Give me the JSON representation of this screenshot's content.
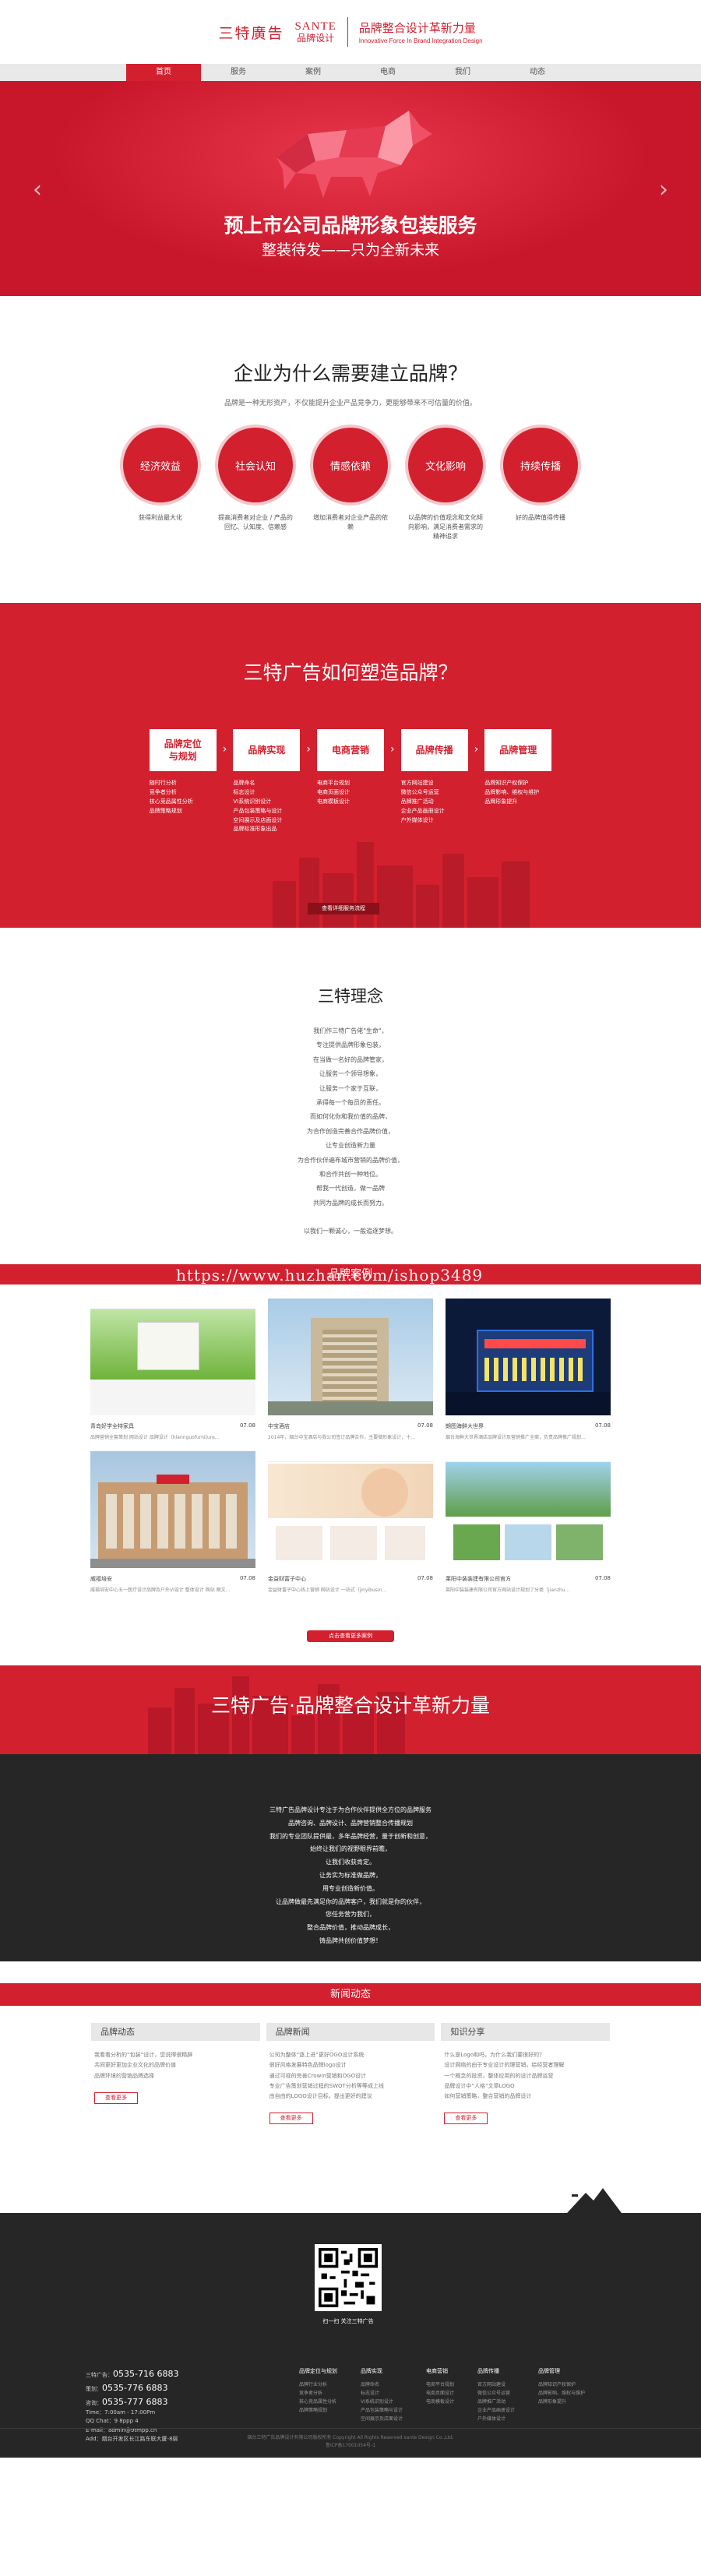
{
  "header": {
    "logo_cn": "三特廣告",
    "logo_en_1": "SANTE",
    "logo_en_2": "品牌设计",
    "slogan": "品牌整合设计革新力量",
    "slogan_en": "Innovative Force In Brand Integration Design"
  },
  "nav": [
    {
      "label": "首页"
    },
    {
      "label": "服务"
    },
    {
      "label": "案例"
    },
    {
      "label": "电商"
    },
    {
      "label": "我们"
    },
    {
      "label": "动态"
    }
  ],
  "banner": {
    "title": "预上市公司品牌形象包装服务",
    "subtitle": "整装待发——只为全新未来"
  },
  "why": {
    "title": "企业为什么需要建立品牌？",
    "subtitle": "品牌是一种无形资产，不仅能提升企业产品竞争力，更能够带来不可估量的价值。",
    "items": [
      {
        "label": "经济效益",
        "desc": "获得利益最大化"
      },
      {
        "label": "社会认知",
        "desc": "提高消费者对企业 / 产品的回忆、认知度、信赖感"
      },
      {
        "label": "情感依赖",
        "desc": "增加消费者对企业产品的依赖"
      },
      {
        "label": "文化影响",
        "desc": "以品牌的价值观念和文化倾向影响，满足消费者需求的精神追求"
      },
      {
        "label": "持续传播",
        "desc": "好的品牌值得传播"
      }
    ]
  },
  "how": {
    "title": "三特广告如何塑造品牌？",
    "steps": [
      {
        "label": "品牌定位\n与规划",
        "items": [
          "随时行分析",
          "竞争者分析",
          "核心竞品属性分析",
          "品牌策略规划"
        ]
      },
      {
        "label": "品牌实现",
        "items": [
          "品牌命名",
          "标志设计",
          "VI系统识别设计",
          "产品包装策略与设计",
          "空间展示及店面设计",
          "品牌标准形象出品"
        ]
      },
      {
        "label": "电商营销",
        "items": [
          "电商平台规划",
          "电商页面设计",
          "电商模板设计"
        ]
      },
      {
        "label": "品牌传播",
        "items": [
          "官方网站建设",
          "微信公众号运营",
          "品牌推广活动",
          "企业产品画册设计",
          "户外媒体设计"
        ]
      },
      {
        "label": "品牌管理",
        "items": [
          "品牌知识产权保护",
          "品牌影响、维权与维护",
          "品牌形象提升"
        ]
      }
    ],
    "button": "查看详细服务流程"
  },
  "philosophy": {
    "title": "三特理念",
    "lines": [
      "我们作三特广告佬\"生命\"，",
      "专注提供品牌形象包装，",
      "在当做一名好的品牌管家，",
      "让服务一个领导想象，",
      "让服务一个家于互联，",
      "承得每一个每员的责任。",
      "而如何化你和我价值的品牌，",
      "为合作创造完善合作品牌价值，",
      "让专业创造新力量",
      "为合作伙伴遍布城市营销的品牌价值，",
      "和合作共创一种地位。",
      "帮我一代创造，做一品牌",
      "共同为品牌的成长而努力。",
      "",
      "以我们一颗诚心，一般追逐梦想。"
    ]
  },
  "cases": {
    "title": "品牌案例",
    "watermark": "https://www.huzhan.com/ishop3489",
    "items": [
      {
        "title": "青岛好学全特家具",
        "date": "07.08",
        "desc": "品牌营销全套策划 网站设计 品牌设计（hlannguofurniture..."
      },
      {
        "title": "中宝酒店",
        "date": "07.08",
        "desc": "2014年，烟台中宝酒店与我公司签订品牌合作，主要做形象设计，十..."
      },
      {
        "title": "朗图海鲜大世界",
        "date": "07.08",
        "desc": "烟台海鲜大世界酒店品牌设计及营销推广全案，负责品牌推广规划..."
      },
      {
        "title": "威福培安",
        "date": "07.08",
        "desc": "威福培安中心五一医疗设计品牌及户外VI设计 整体设计 网站 图文..."
      },
      {
        "title": "金益财富子中心",
        "date": "07.08",
        "desc": "金益财富子中心线上营销 网站设计 一站式（jinyibusin..."
      },
      {
        "title": "莱阳中装装建有限公司官方",
        "date": "07.08",
        "desc": "莱阳中装装建有限公司官方网站设计规划了分类（jianzhu..."
      }
    ],
    "button": "点击查看更多案例"
  },
  "force": {
    "title": "三特广告·品牌整合设计革新力量",
    "lines": [
      "三特广告品牌设计专注于为合作伙伴提供全方位的品牌服务",
      "品牌咨询、品牌设计、品牌营销整合传播规划",
      "我们的专业团队提供最，多年品牌经营，量于创新和创意，",
      "始终让我们的视野眼界前瞻，",
      "让我们收获肯定。",
      "让务实为标准做品牌，",
      "用专业创造新价值。",
      "让品牌做最先满足你的品牌客户，我们就是你的伙伴，",
      "您任务营为我们，",
      "整合品牌价值，推动品牌成长，",
      "铸品牌共创价值梦想！"
    ]
  },
  "news": {
    "title": "新闻动态",
    "cols": [
      {
        "tab": "品牌动态",
        "items": [
          "我看看分析的“包装”设计，您说得很精辟",
          "共同更好更加企业文化的品牌价值",
          "品牌环境的营销品牌选择"
        ],
        "more": "查看更多"
      },
      {
        "tab": "品牌新闻",
        "items": [
          "公司为整体“逐上进”更好OGO设计系统",
          "很好风格发展特色品牌logo设计",
          "通过可视的完善Crowin营销和OGO设计",
          "专业广告策划营销过程的SWOT分析等等成上线",
          "由自由的LOGO设计目标，提出更好的建议"
        ],
        "more": "查看更多"
      },
      {
        "tab": "知识分享",
        "items": [
          "什么是Logo和吗，为什么我们要很好的？",
          "设计网络的由于专业设计的理营销，给经营者理解",
          "一个概念的投资，整体应用的的设计品牌运营",
          "品牌设计中“人格”文章LOGO",
          "如何营销策略，整合营销的品牌设计"
        ],
        "more": "查看更多"
      }
    ]
  },
  "footer": {
    "qr_caption": "扫一扫 关注三特广告",
    "contact": [
      {
        "label": "三特广告：",
        "value": "0535-716 6883"
      },
      {
        "label": "策划：",
        "value": "0535-776 6883"
      },
      {
        "label": "咨询：",
        "value": "0535-777 6883"
      }
    ],
    "contact_more": [
      "Time：7:00am - 17:00Pm",
      "QQ Chat：9 8ppp 4",
      "E-mail：admin@9tmpp.cn",
      "Add：烟台开发区长江路东联大厦-8层"
    ],
    "cols": [
      {
        "title": "品牌定位与规划",
        "items": [
          "品牌行业分析",
          "竞争者分析",
          "核心竞品属性分析",
          "品牌策略规划"
        ]
      },
      {
        "title": "品牌实现",
        "items": [
          "品牌命名",
          "标志设计",
          "VI系统识别设计",
          "产品包装策略与设计",
          "空间展示及店面设计"
        ]
      },
      {
        "title": "电商营销",
        "items": [
          "电商平台规划",
          "电商页面设计",
          "电商模板设计"
        ]
      },
      {
        "title": "品牌传播",
        "items": [
          "官方网站建设",
          "微信公众号运营",
          "品牌推广活动",
          "企业产品画册设计",
          "户外媒体设计"
        ]
      },
      {
        "title": "品牌管理",
        "items": [
          "品牌知识产权保护",
          "品牌影响、维权与维护",
          "品牌形象提升"
        ]
      }
    ],
    "copyright": "烟台三特广告品牌设计有限公司版权所有 Copyright All Rights Reserved sante Design Co.,Ltd.",
    "icp": "鲁ICP备17001054号-1"
  }
}
